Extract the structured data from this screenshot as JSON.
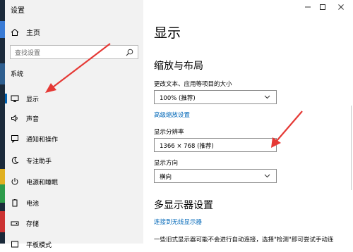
{
  "window": {
    "title": "设置"
  },
  "sidebar": {
    "home_label": "主页",
    "search_placeholder": "查找设置",
    "section_label": "系统",
    "items": [
      {
        "label": "显示",
        "icon": "monitor-icon",
        "active": true
      },
      {
        "label": "声音",
        "icon": "speaker-icon"
      },
      {
        "label": "通知和操作",
        "icon": "notification-icon"
      },
      {
        "label": "专注助手",
        "icon": "moon-icon"
      },
      {
        "label": "电源和睡眠",
        "icon": "power-icon"
      },
      {
        "label": "电池",
        "icon": "battery-icon"
      },
      {
        "label": "存储",
        "icon": "storage-icon"
      },
      {
        "label": "平板模式",
        "icon": "tablet-icon"
      }
    ]
  },
  "main": {
    "title": "显示",
    "scale_section": {
      "heading": "缩放与布局",
      "text_size_label": "更改文本、应用等项目的大小",
      "text_size_value": "100% (推荐)",
      "advanced_link": "高级缩放设置",
      "resolution_label": "显示分辨率",
      "resolution_value": "1366 × 768 (推荐)",
      "orientation_label": "显示方向",
      "orientation_value": "横向"
    },
    "multi_display": {
      "heading": "多显示器设置",
      "wireless_link": "连接到无线显示器",
      "description": "一些旧式显示器可能不会进行自动连接，选择\"检测\"即可尝试手动连"
    }
  },
  "colors": {
    "accent": "#0067b8",
    "annotation_arrow": "#e53935",
    "sidebar_bg": "#f2f2f2"
  }
}
